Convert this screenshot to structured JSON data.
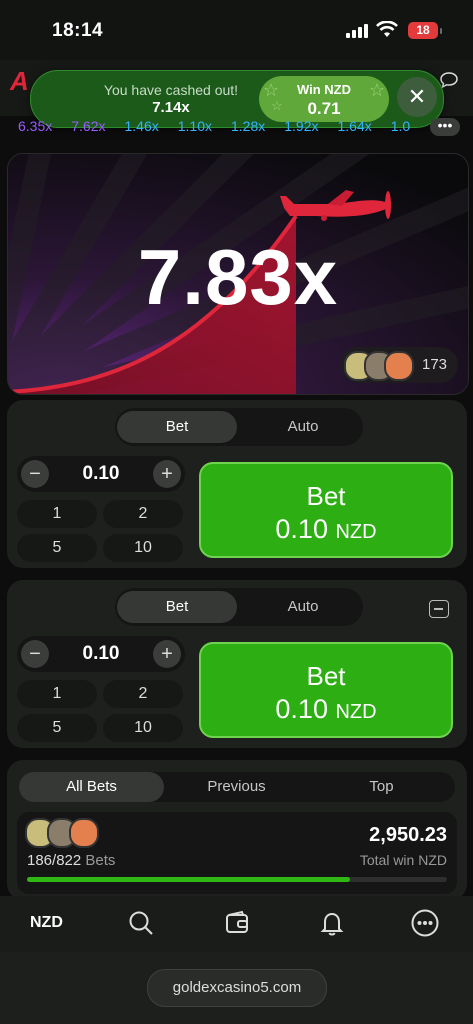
{
  "status_bar": {
    "time": "18:14",
    "battery": "18"
  },
  "toast": {
    "message": "You have cashed out!",
    "multiplier": "7.14x",
    "win_label": "Win NZD",
    "win_value": "0.71",
    "close_icon": "close-icon"
  },
  "history": [
    "6.35x",
    "7.62x",
    "1.46x",
    "1.10x",
    "1.28x",
    "1.92x",
    "1.64x",
    "1.0"
  ],
  "history_more": "•••",
  "game": {
    "multiplier": "7.83x",
    "players_count": "173"
  },
  "panels": [
    {
      "tab_bet": "Bet",
      "tab_auto": "Auto",
      "amount": "0.10",
      "quick": [
        "1",
        "2",
        "5",
        "10"
      ],
      "bet_label": "Bet",
      "bet_amount": "0.10",
      "bet_currency": "NZD"
    },
    {
      "tab_bet": "Bet",
      "tab_auto": "Auto",
      "amount": "0.10",
      "quick": [
        "1",
        "2",
        "5",
        "10"
      ],
      "bet_label": "Bet",
      "bet_amount": "0.10",
      "bet_currency": "NZD"
    }
  ],
  "bets": {
    "tabs": [
      "All Bets",
      "Previous",
      "Top"
    ],
    "count": "186/822",
    "count_label": "Bets",
    "total": "2,950.23",
    "total_label": "Total win NZD",
    "progress": 0.77
  },
  "nav": {
    "currency": "NZD",
    "icons": [
      "search-icon",
      "wallet-icon",
      "bell-icon",
      "more-icon"
    ]
  },
  "browser": {
    "url": "goldexcasino5.com"
  },
  "colors": {
    "accent_green": "#2dae12",
    "plane_red": "#e0263a",
    "history_blue": "#34b4ff",
    "history_purple": "#9b5cff"
  }
}
